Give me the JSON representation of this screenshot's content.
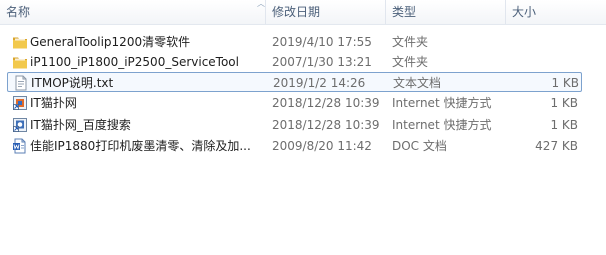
{
  "header": {
    "name": "名称",
    "date": "修改日期",
    "type": "类型",
    "size": "大小"
  },
  "files": [
    {
      "name": "GeneralToolip1200清零软件",
      "date": "2019/4/10 17:55",
      "type": "文件夹",
      "size": "",
      "icon": "folder-icon"
    },
    {
      "name": "iP1100_iP1800_iP2500_ServiceTool",
      "date": "2007/1/30 13:21",
      "type": "文件夹",
      "size": "",
      "icon": "folder-icon"
    },
    {
      "name": "ITMOP说明.txt",
      "date": "2019/1/2 14:26",
      "type": "文本文档",
      "size": "1 KB",
      "icon": "text-file-icon",
      "selected": true
    },
    {
      "name": "IT猫扑网",
      "date": "2018/12/28 10:39",
      "type": "Internet 快捷方式",
      "size": "1 KB",
      "icon": "internet-shortcut-icon"
    },
    {
      "name": "IT猫扑网_百度搜索",
      "date": "2018/12/28 10:39",
      "type": "Internet 快捷方式",
      "size": "1 KB",
      "icon": "internet-shortcut-icon"
    },
    {
      "name": "佳能IP1880打印机废墨清零、清除及加...",
      "date": "2009/8/20 11:42",
      "type": "DOC 文档",
      "size": "427 KB",
      "icon": "word-doc-icon"
    }
  ],
  "colors": {
    "selection_border": "#7da2ce",
    "header_text": "#4c607a",
    "folder": "#e8b83c"
  }
}
